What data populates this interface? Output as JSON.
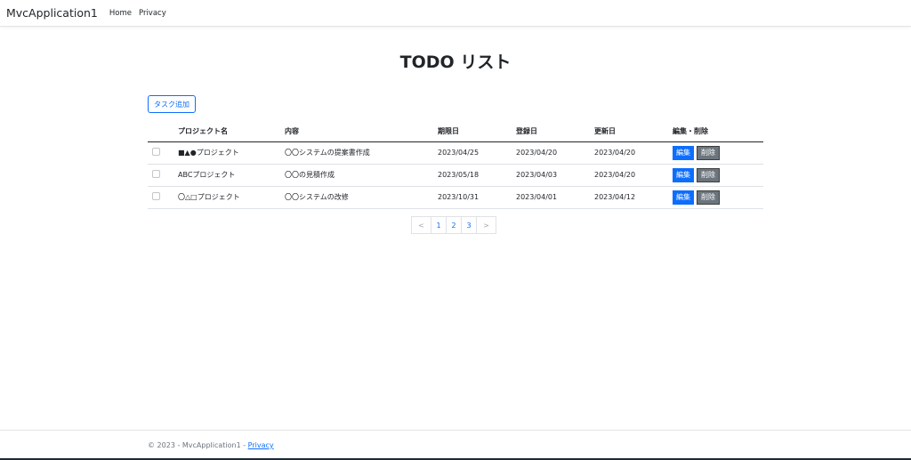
{
  "nav": {
    "brand": "MvcApplication1",
    "links": [
      "Home",
      "Privacy"
    ]
  },
  "page": {
    "title": "TODO リスト",
    "add_button": "タスク追加"
  },
  "table": {
    "headers": [
      "プロジェクト名",
      "内容",
      "期限日",
      "登録日",
      "更新日",
      "編集・削除"
    ],
    "rows": [
      {
        "project": "■▲●プロジェクト",
        "content": "〇〇システムの提案書作成",
        "due": "2023/04/25",
        "created": "2023/04/20",
        "updated": "2023/04/20"
      },
      {
        "project": "ABCプロジェクト",
        "content": "〇〇の見積作成",
        "due": "2023/05/18",
        "created": "2023/04/03",
        "updated": "2023/04/20"
      },
      {
        "project": "〇△□プロジェクト",
        "content": "〇〇システムの改修",
        "due": "2023/10/31",
        "created": "2023/04/01",
        "updated": "2023/04/12"
      }
    ],
    "edit_label": "編集",
    "delete_label": "削除"
  },
  "pagination": {
    "prev": "<",
    "pages": [
      "1",
      "2",
      "3"
    ],
    "next": ">"
  },
  "footer": {
    "text": "© 2023 - MvcApplication1 - ",
    "link": "Privacy"
  },
  "colors": {
    "primary": "#0d6efd",
    "secondary": "#6c757d"
  }
}
